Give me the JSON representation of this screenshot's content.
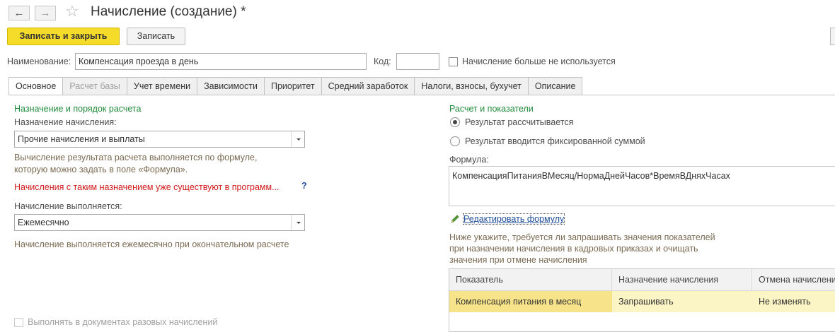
{
  "window": {
    "title": "Начисление (создание) *",
    "back_label": "←",
    "forward_label": "→",
    "star_label": "☆"
  },
  "toolbar": {
    "save_close_label": "Записать и закрыть",
    "save_label": "Записать"
  },
  "header": {
    "name_label": "Наименование:",
    "name_value": "Компенсация проезда в день",
    "code_label": "Код:",
    "code_value": "",
    "unused_label": "Начисление больше не используется"
  },
  "tabs": [
    {
      "label": "Основное",
      "active": true,
      "disabled": false
    },
    {
      "label": "Расчет базы",
      "active": false,
      "disabled": true
    },
    {
      "label": "Учет времени",
      "active": false,
      "disabled": false
    },
    {
      "label": "Зависимости",
      "active": false,
      "disabled": false
    },
    {
      "label": "Приоритет",
      "active": false,
      "disabled": false
    },
    {
      "label": "Средний заработок",
      "active": false,
      "disabled": false
    },
    {
      "label": "Налоги, взносы, бухучет",
      "active": false,
      "disabled": false
    },
    {
      "label": "Описание",
      "active": false,
      "disabled": false
    }
  ],
  "left": {
    "section_title": "Назначение и порядок расчета",
    "purpose_label": "Назначение начисления:",
    "purpose_value": "Прочие начисления и выплаты",
    "purpose_hint_1": "Вычисление результата расчета выполняется по формуле,",
    "purpose_hint_2": "которую можно задать в поле «Формула».",
    "warning": "Начисления с таким назначением уже существуют в программ...",
    "question_mark": "?",
    "execution_label": "Начисление выполняется:",
    "execution_value": "Ежемесячно",
    "execution_hint": "Начисление выполняется ежемесячно при окончательном расчете",
    "one_time_label": "Выполнять в документах разовых начислений"
  },
  "right": {
    "section_title": "Расчет и показатели",
    "radio_calculated": "Результат рассчитывается",
    "radio_fixed": "Результат вводится фиксированной суммой",
    "formula_label": "Формула:",
    "formula_value": "КомпенсацияПитанияВМесяц/НормаДнейЧасов*ВремяВДняхЧасах",
    "edit_formula_label": "Редактировать формулу",
    "info_1": "Ниже укажите, требуется ли запрашивать значения показателей",
    "info_2": "при назначении начисления в кадровых приказах и очищать",
    "info_3": "значения при отмене начисления"
  },
  "indicators_table": {
    "columns": [
      "Показатель",
      "Назначение начисления",
      "Отмена начисления"
    ],
    "rows": [
      [
        "Компенсация питания в месяц",
        "Запрашивать",
        "Не изменять"
      ]
    ]
  },
  "colors": {
    "accent_button": "#f6dc2a",
    "section_title": "#1f8a3a",
    "warning": "#d11a1a",
    "hint": "#7a6a52",
    "selected_row": "#fbf4c4"
  }
}
